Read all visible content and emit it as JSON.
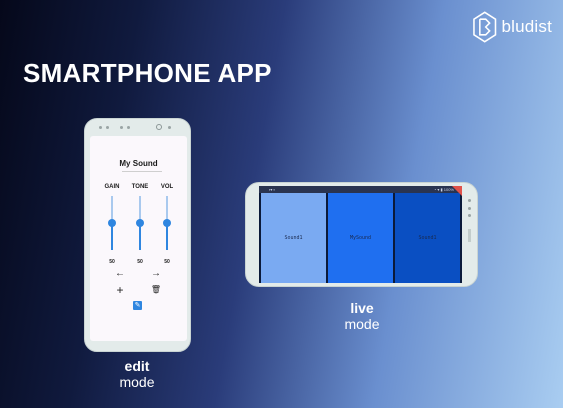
{
  "brand": {
    "name": "bludist"
  },
  "title": "SMARTPHONE APP",
  "edit_phone": {
    "sound_name": "My Sound",
    "controls": [
      {
        "label": "GAIN",
        "value": "50",
        "level": 0.5
      },
      {
        "label": "TONE",
        "value": "50",
        "level": 0.5
      },
      {
        "label": "VOL",
        "value": "50",
        "level": 0.5
      }
    ],
    "icons": {
      "prev": "←",
      "next": "→",
      "add": "+",
      "delete": "🗑",
      "edit": "✎"
    },
    "nav": {
      "back": "◁",
      "home": "○",
      "recent": "□"
    }
  },
  "edit_mode": {
    "bold": "edit",
    "normal": "mode"
  },
  "live_phone": {
    "status_left": "▪▾ ▪",
    "status_right": "◔ ▾ ▮ 100%",
    "tiles": [
      {
        "label": "Sound1",
        "color": "#7aaaf2"
      },
      {
        "label": "MySound",
        "color": "#1f6ff0"
      },
      {
        "label": "Sound1",
        "color": "#0a4fc2"
      }
    ]
  },
  "live_mode": {
    "bold": "live",
    "normal": "mode"
  }
}
